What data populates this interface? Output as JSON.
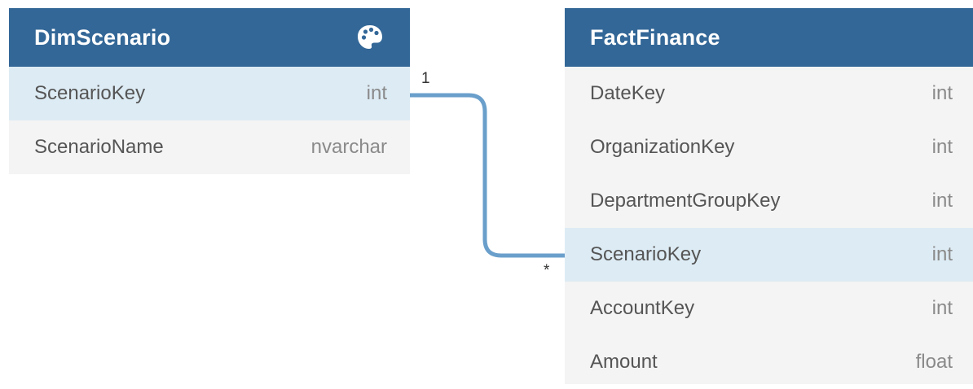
{
  "tables": [
    {
      "title": "DimScenario",
      "icon": "palette-icon",
      "columns": [
        {
          "name": "ScenarioKey",
          "type": "int"
        },
        {
          "name": "ScenarioName",
          "type": "nvarchar"
        }
      ]
    },
    {
      "title": "FactFinance",
      "columns": [
        {
          "name": "DateKey",
          "type": "int"
        },
        {
          "name": "OrganizationKey",
          "type": "int"
        },
        {
          "name": "DepartmentGroupKey",
          "type": "int"
        },
        {
          "name": "ScenarioKey",
          "type": "int"
        },
        {
          "name": "AccountKey",
          "type": "int"
        },
        {
          "name": "Amount",
          "type": "float"
        }
      ]
    }
  ],
  "relationship": {
    "from_cardinality": "1",
    "to_cardinality": "*"
  },
  "colors": {
    "header": "#336797",
    "highlight": "#ddebf4",
    "connector": "#6a9fcb"
  }
}
